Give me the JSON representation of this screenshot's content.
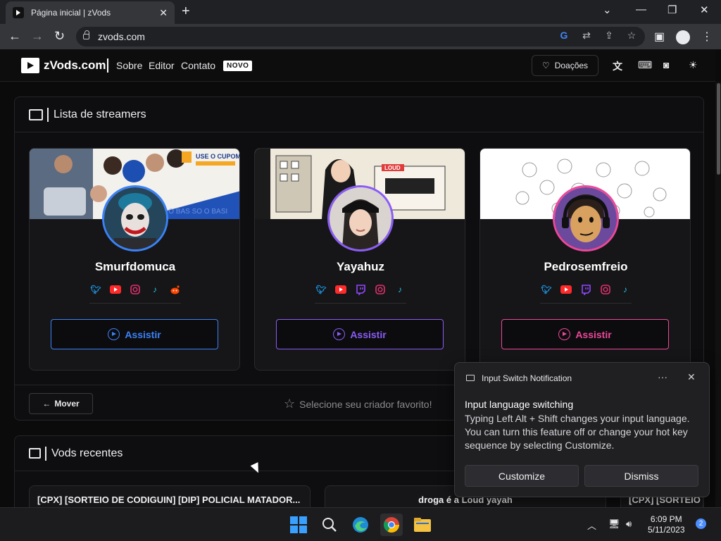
{
  "browser": {
    "tab_title": "Página inicial | zVods",
    "address": "zvods.com",
    "new_tab": "+",
    "tab_close": "✕"
  },
  "site": {
    "brand": "zVods.com",
    "nav": [
      "Sobre",
      "Editor",
      "Contato"
    ],
    "new_badge": "NOVO",
    "donate_label": "Doações"
  },
  "streamers_panel": {
    "title": "Lista de streamers",
    "cards": [
      {
        "name": "Smurfdomuca",
        "watch_label": "Assistir",
        "accent": "#3b82f6",
        "banner_text": "USE O CUPOM",
        "socials": [
          "twitter-icon",
          "youtube-icon",
          "instagram-icon",
          "tiktok-icon",
          "reddit-icon"
        ]
      },
      {
        "name": "Yayahuz",
        "watch_label": "Assistir",
        "accent": "#8b5cf6",
        "banner_text": "LOUD",
        "socials": [
          "twitter-icon",
          "youtube-icon",
          "twitch-icon",
          "instagram-icon",
          "tiktok-icon"
        ]
      },
      {
        "name": "Pedrosemfreio",
        "watch_label": "Assistir",
        "accent": "#ec4899",
        "socials": [
          "twitter-icon",
          "youtube-icon",
          "twitch-icon",
          "instagram-icon",
          "tiktok-icon"
        ]
      }
    ],
    "move_label": "Mover",
    "favorite_hint": "Selecione seu criador favorito!"
  },
  "vods_panel": {
    "title": "Vods recentes",
    "items": [
      "[CPX] [SORTEIO DE CODIGUIN] [DIP] POLICIAL MATADOR...",
      "droga é a Loud yayah",
      "[CPX] [SORTEIO D"
    ]
  },
  "notification": {
    "app_title": "Input Switch Notification",
    "heading": "Input language switching",
    "body": "Typing Left Alt + Shift changes your input language. You can turn this feature off or change your hot key sequence by selecting Customize.",
    "customize_label": "Customize",
    "dismiss_label": "Dismiss"
  },
  "taskbar": {
    "time": "6:09 PM",
    "date": "5/11/2023",
    "notification_count": "2"
  },
  "colors": {
    "twitter": "#1d9bf0",
    "youtube": "#ff2a2a",
    "instagram": "#e1306c",
    "twitch": "#9146ff",
    "tiktok": "#25c4e8",
    "reddit": "#ff4500"
  }
}
